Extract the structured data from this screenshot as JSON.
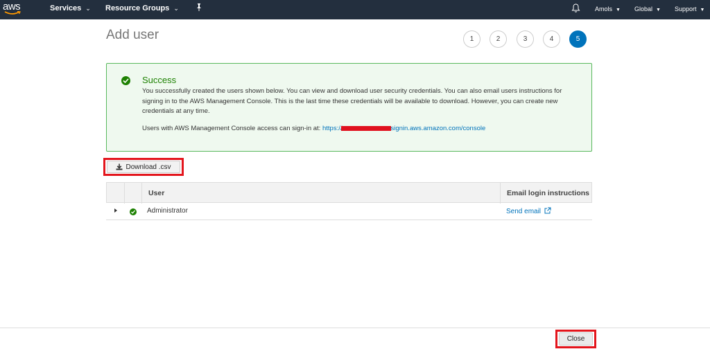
{
  "nav": {
    "logo_text": "aws",
    "services": "Services",
    "resource_groups": "Resource Groups",
    "user": "Amols",
    "region": "Global",
    "support": "Support",
    "chevron": "⌄"
  },
  "page": {
    "title": "Add user",
    "steps": [
      "1",
      "2",
      "3",
      "4",
      "5"
    ],
    "active_step": "5"
  },
  "success": {
    "heading": "Success",
    "body": "You successfully created the users shown below. You can view and download user security credentials. You can also email users instructions for signing in to the AWS Management Console. This is the last time these credentials will be available to download. However, you can create new credentials at any time.",
    "signin_prefix": "Users with AWS Management Console access can sign-in at:",
    "link_start": "https://",
    "link_end": "signin.aws.amazon.com/console"
  },
  "download": {
    "label": "Download .csv"
  },
  "table": {
    "headers": {
      "user": "User",
      "email": "Email login instructions"
    },
    "rows": [
      {
        "user": "Administrator",
        "email_link": "Send email"
      }
    ]
  },
  "footer": {
    "close_label": "Close"
  },
  "colors": {
    "nav_bg": "#232f3e",
    "accent": "#0073bb",
    "success_green": "#1d8102",
    "highlight_red": "#e3151c"
  }
}
